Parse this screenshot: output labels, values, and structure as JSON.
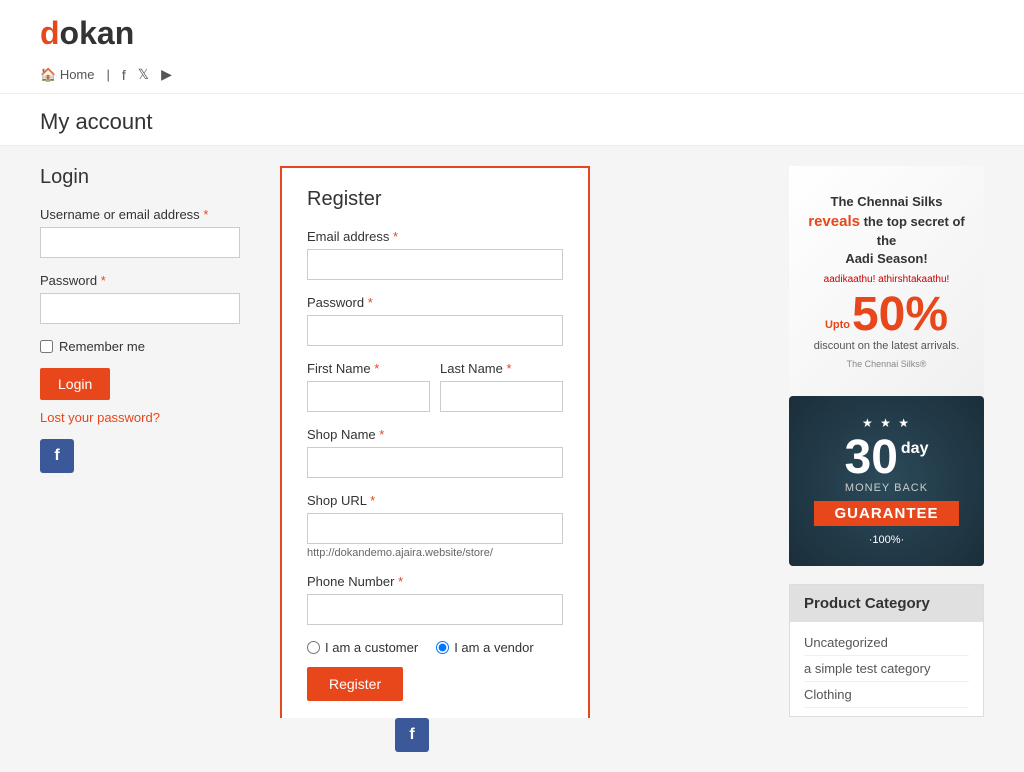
{
  "site": {
    "logo_text": "dokan",
    "logo_d": "d"
  },
  "nav": {
    "home_label": "Home",
    "icons": [
      "facebook-icon",
      "twitter-icon",
      "youtube-icon"
    ]
  },
  "page": {
    "title": "My account"
  },
  "login": {
    "heading": "Login",
    "username_label": "Username or email address",
    "password_label": "Password",
    "remember_label": "Remember me",
    "login_button": "Login",
    "lost_password": "Lost your password?"
  },
  "register": {
    "heading": "Register",
    "email_label": "Email address",
    "password_label": "Password",
    "first_name_label": "First Name",
    "last_name_label": "Last Name",
    "shop_name_label": "Shop Name",
    "shop_url_label": "Shop URL",
    "shop_url_hint": "http://dokandemo.ajaira.website/store/",
    "phone_label": "Phone Number",
    "customer_radio": "I am a customer",
    "vendor_radio": "I am a vendor",
    "register_button": "Register"
  },
  "ad_banner": {
    "line1": "The Chennai Silks",
    "line2": "reveals",
    "line3": "the top secret",
    "line4": "of the",
    "line5": "Aadi Season!",
    "percent": "50%",
    "subtitle": "discount on the latest arrivals."
  },
  "guarantee": {
    "days": "30",
    "day_label": "day",
    "money_back": "MONEY BACK",
    "banner": "GUARANTEE",
    "hundred": "·100%·"
  },
  "product_category": {
    "title": "Product Category",
    "items": [
      {
        "label": "Uncategorized",
        "href": "#"
      },
      {
        "label": "a simple test category",
        "href": "#"
      },
      {
        "label": "Clothing",
        "href": "#"
      }
    ]
  }
}
